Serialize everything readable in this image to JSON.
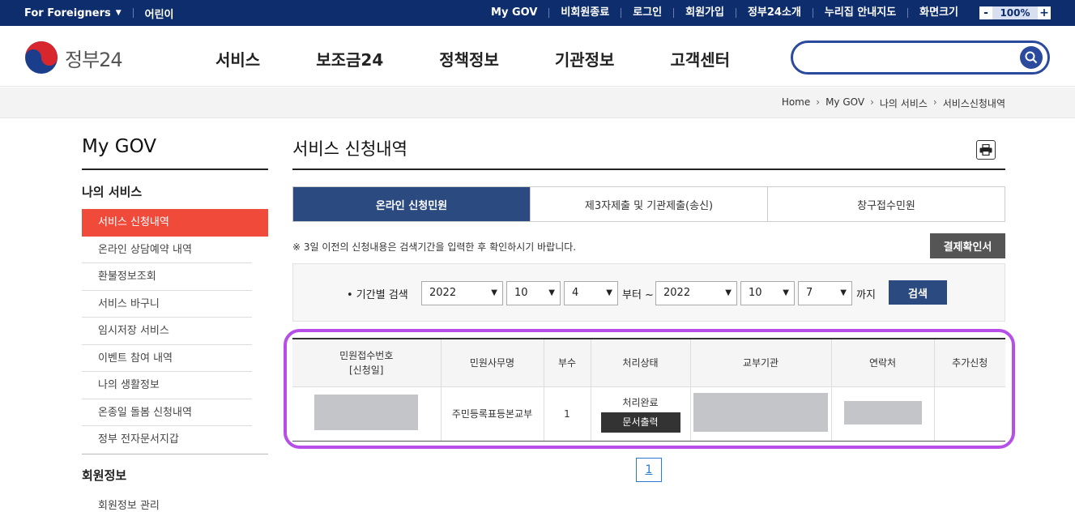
{
  "topbar": {
    "foreigners": "For Foreigners",
    "kids": "어린이",
    "links": [
      "My GOV",
      "비회원종료",
      "로그인",
      "회원가입",
      "정부24소개",
      "누리집 안내지도",
      "화면크기"
    ],
    "zoom_minus": "-",
    "zoom_value": "100%",
    "zoom_plus": "+"
  },
  "header": {
    "logo_text": "정부24",
    "gnb": [
      "서비스",
      "보조금24",
      "정책정보",
      "기관정보",
      "고객센터"
    ],
    "search_placeholder": ""
  },
  "breadcrumb": [
    "Home",
    "My GOV",
    "나의 서비스",
    "서비스신청내역"
  ],
  "sidebar": {
    "title": "My GOV",
    "section1": "나의 서비스",
    "items": [
      "서비스 신청내역",
      "온라인 상담예약 내역",
      "환불정보조회",
      "서비스 바구니",
      "임시저장 서비스",
      "이벤트 참여 내역",
      "나의 생활정보",
      "온종일 돌봄 신청내역",
      "정부 전자문서지갑"
    ],
    "section2": "회원정보",
    "items2": [
      "회원정보 관리"
    ]
  },
  "main": {
    "title": "서비스 신청내역",
    "tabs": [
      "온라인 신청민원",
      "제3자제출 및 기관제출(송신)",
      "창구접수민원"
    ],
    "notice": "※ 3일 이전의 신청내용은 검색기간을 입력한 후 확인하시기 바랍니다.",
    "pay_button": "결제확인서",
    "filter": {
      "label": "• 기간별 검색",
      "from_year": "2022",
      "from_month": "10",
      "from_day": "4",
      "from_text": "부터 ~",
      "to_year": "2022",
      "to_month": "10",
      "to_day": "7",
      "to_text": "까지",
      "search_button": "검색"
    },
    "table": {
      "headers": [
        "민원접수번호",
        "[신청일]",
        "민원사무명",
        "부수",
        "처리상태",
        "교부기관",
        "연락처",
        "추가신청"
      ],
      "row": {
        "service_name": "주민등록표등본교부",
        "copies": "1",
        "status": "처리완료",
        "print_button": "문서출력"
      }
    },
    "pagination": [
      "1"
    ]
  },
  "colors": {
    "topbar": "#0d2d6c",
    "accent_blue": "#2a4a80",
    "active_red": "#f04a3a",
    "highlight": "#b54fe8"
  }
}
